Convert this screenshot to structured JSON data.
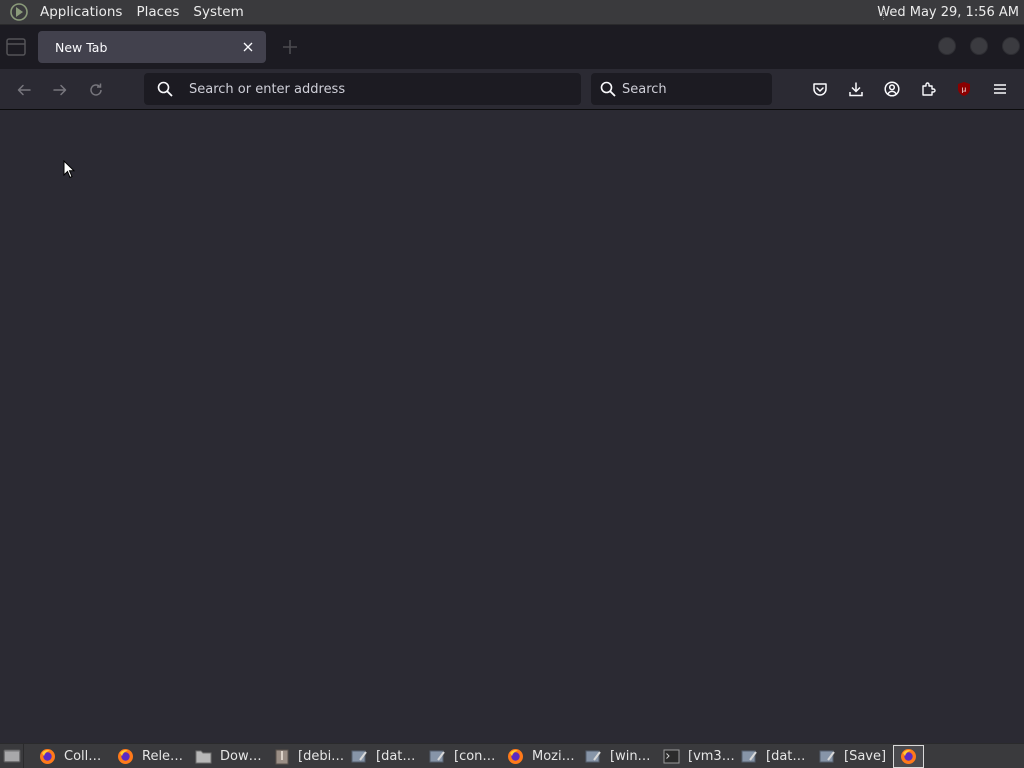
{
  "top_panel": {
    "menus": [
      "Applications",
      "Places",
      "System"
    ],
    "clock": "Wed May 29,  1:56 AM"
  },
  "browser": {
    "tab": {
      "title": "New Tab"
    },
    "urlbar": {
      "placeholder": "Search or enter address"
    },
    "searchbar": {
      "placeholder": "Search"
    },
    "toolbar_icons": [
      "pocket-icon",
      "downloads-icon",
      "account-icon",
      "extensions-icon",
      "ublock-icon",
      "menu-icon"
    ],
    "ublock_badge": "μ",
    "accent_ublock": "#8b0000"
  },
  "taskbar": {
    "items": [
      {
        "label": "Coll…",
        "icon": "firefox-icon"
      },
      {
        "label": "Rele…",
        "icon": "firefox-icon"
      },
      {
        "label": "Dow…",
        "icon": "folder-icon"
      },
      {
        "label": "[debi…",
        "icon": "archive-icon"
      },
      {
        "label": "[dat…",
        "icon": "editor-icon"
      },
      {
        "label": "[con…",
        "icon": "editor-icon"
      },
      {
        "label": "Mozi…",
        "icon": "firefox-icon"
      },
      {
        "label": "[win…",
        "icon": "editor-icon"
      },
      {
        "label": "[vm3…",
        "icon": "terminal-icon"
      },
      {
        "label": "[dat…",
        "icon": "editor-icon"
      },
      {
        "label": "[Save]",
        "icon": "editor-icon"
      },
      {
        "label": "",
        "icon": "firefox-icon",
        "active": true
      }
    ]
  }
}
